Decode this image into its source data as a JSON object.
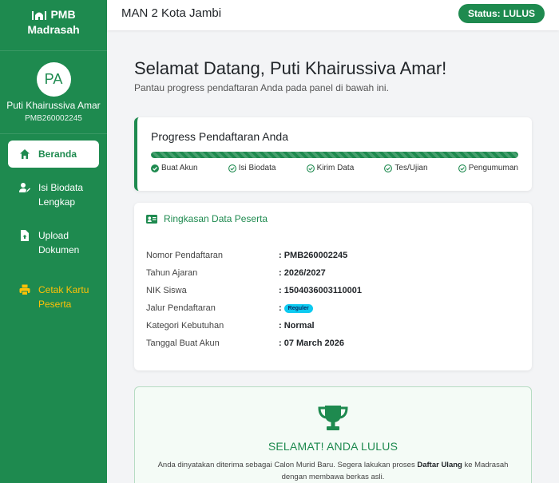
{
  "sidebar": {
    "brand_line1": "PMB",
    "brand_line2": "Madrasah",
    "avatar_initials": "PA",
    "user_name": "Puti Khairussiva Amar",
    "user_id": "PMB260002245",
    "items": [
      {
        "label": "Beranda",
        "icon": "home-icon"
      },
      {
        "label_line1": "Isi Biodata",
        "label_line2": "Lengkap",
        "icon": "user-edit-icon"
      },
      {
        "label_line1": "Upload",
        "label_line2": "Dokumen",
        "icon": "file-upload-icon"
      },
      {
        "label_line1": "Cetak Kartu",
        "label_line2": "Peserta",
        "icon": "printer-icon"
      }
    ]
  },
  "topbar": {
    "school_name": "MAN 2 Kota Jambi",
    "status": "Status: LULUS"
  },
  "welcome": {
    "title": "Selamat Datang, Puti Khairussiva Amar!",
    "subtitle": "Pantau progress pendaftaran Anda pada panel di bawah ini."
  },
  "progress": {
    "title": "Progress Pendaftaran Anda",
    "percent": 100,
    "steps": [
      "Buat Akun",
      "Isi Biodata",
      "Kirim Data",
      "Tes/Ujian",
      "Pengumuman"
    ]
  },
  "summary": {
    "title": "Ringkasan Data Peserta",
    "rows": [
      {
        "label": "Nomor Pendaftaran",
        "value": ": PMB260002245"
      },
      {
        "label": "Tahun Ajaran",
        "value": ": 2026/2027"
      },
      {
        "label": "NIK Siswa",
        "value": ": 1504036003110001"
      },
      {
        "label": "Jalur Pendaftaran",
        "value": ":",
        "badge": "Reguler"
      },
      {
        "label": "Kategori Kebutuhan",
        "value": ": Normal"
      },
      {
        "label": "Tanggal Buat Akun",
        "value": ": 07 March 2026"
      }
    ]
  },
  "result": {
    "title": "SELAMAT! ANDA LULUS",
    "text_before": "Anda dinyatakan diterima sebagai Calon Murid Baru. Segera lakukan proses ",
    "text_bold": "Daftar Ulang",
    "text_after": " ke Madrasah dengan membawa berkas asli."
  },
  "colors": {
    "brand": "#1e8a4f",
    "warning": "#ffc107",
    "badge": "#0dcaf0"
  }
}
